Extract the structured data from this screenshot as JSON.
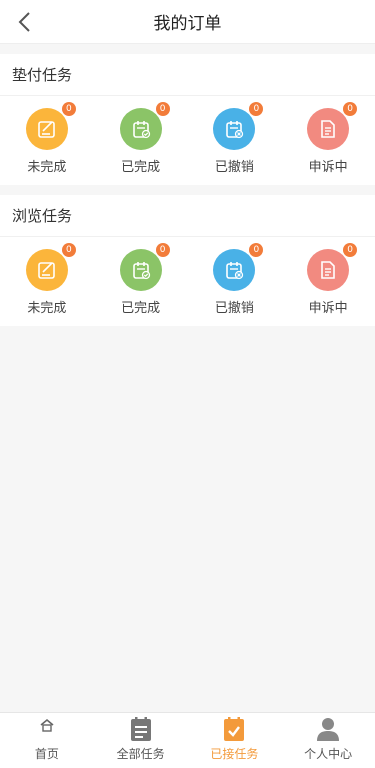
{
  "header": {
    "title": "我的订单"
  },
  "colors": {
    "pending": "#fbb53b",
    "done": "#8bc467",
    "cancelled": "#49b1e7",
    "appeal": "#f28a80",
    "badge": "#f27c3a",
    "active_tab": "#f39a3b"
  },
  "sections": [
    {
      "title": "垫付任务",
      "items": [
        {
          "label": "未完成",
          "count": "0",
          "icon": "edit-icon"
        },
        {
          "label": "已完成",
          "count": "0",
          "icon": "calendar-check-icon"
        },
        {
          "label": "已撤销",
          "count": "0",
          "icon": "calendar-cancel-icon"
        },
        {
          "label": "申诉中",
          "count": "0",
          "icon": "document-icon"
        }
      ]
    },
    {
      "title": "浏览任务",
      "items": [
        {
          "label": "未完成",
          "count": "0",
          "icon": "edit-icon"
        },
        {
          "label": "已完成",
          "count": "0",
          "icon": "calendar-check-icon"
        },
        {
          "label": "已撤销",
          "count": "0",
          "icon": "calendar-cancel-icon"
        },
        {
          "label": "申诉中",
          "count": "0",
          "icon": "document-icon"
        }
      ]
    }
  ],
  "tabs": [
    {
      "label": "首页",
      "icon": "home-icon",
      "active": false
    },
    {
      "label": "全部任务",
      "icon": "list-icon",
      "active": false
    },
    {
      "label": "已接任务",
      "icon": "calendar-check-icon",
      "active": true
    },
    {
      "label": "个人中心",
      "icon": "user-icon",
      "active": false
    }
  ]
}
